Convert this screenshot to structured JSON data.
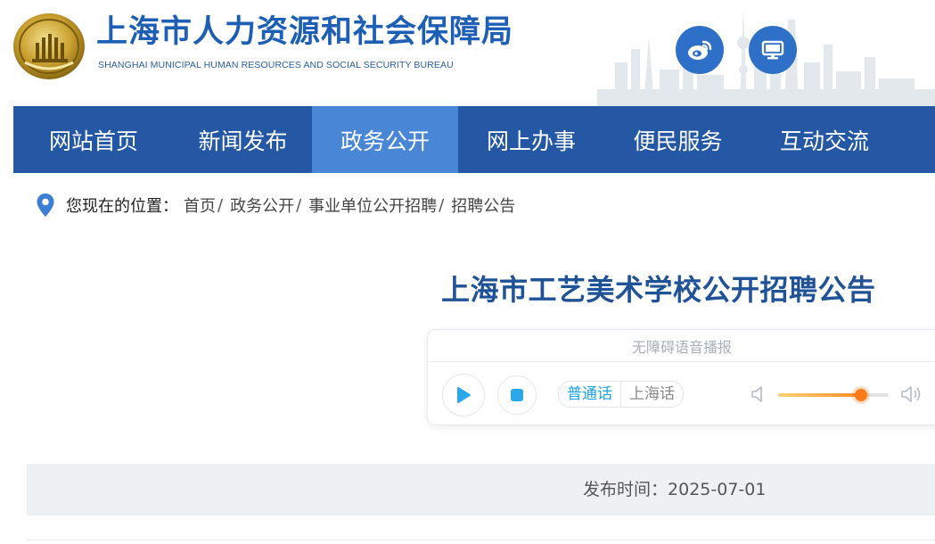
{
  "header": {
    "title": "上海市人力资源和社会保障局",
    "subtitle": "SHANGHAI MUNICIPAL HUMAN RESOURCES AND SOCIAL SECURITY BUREAU"
  },
  "nav": {
    "items": [
      {
        "label": "网站首页"
      },
      {
        "label": "新闻发布"
      },
      {
        "label": "政务公开"
      },
      {
        "label": "网上办事"
      },
      {
        "label": "便民服务"
      },
      {
        "label": "互动交流"
      }
    ],
    "active_index": 2
  },
  "breadcrumb": {
    "prefix": "您现在的位置：",
    "items": [
      {
        "label": "首页"
      },
      {
        "label": "政务公开"
      },
      {
        "label": "事业单位公开招聘"
      },
      {
        "label": "招聘公告"
      }
    ],
    "separator": "/"
  },
  "article": {
    "title": "上海市工艺美术学校公开招聘公告",
    "publish_label": "发布时间：",
    "publish_date": "2025-07-01"
  },
  "player": {
    "heading": "无障碍语音播报",
    "languages": [
      "普通话",
      "上海话"
    ],
    "selected_language": "普通话",
    "volume": 0.75
  },
  "colors": {
    "brand_blue": "#1d5fb4",
    "nav_bg": "#2457a4",
    "nav_active": "#4a86d6",
    "accent_cyan": "#1aa3e8",
    "slider_orange": "#ff7a1a"
  },
  "icons": [
    "emblem-logo",
    "weibo-icon",
    "monitor-icon",
    "location-pin-icon",
    "play-icon",
    "stop-icon",
    "volume-low-icon",
    "volume-high-icon"
  ]
}
